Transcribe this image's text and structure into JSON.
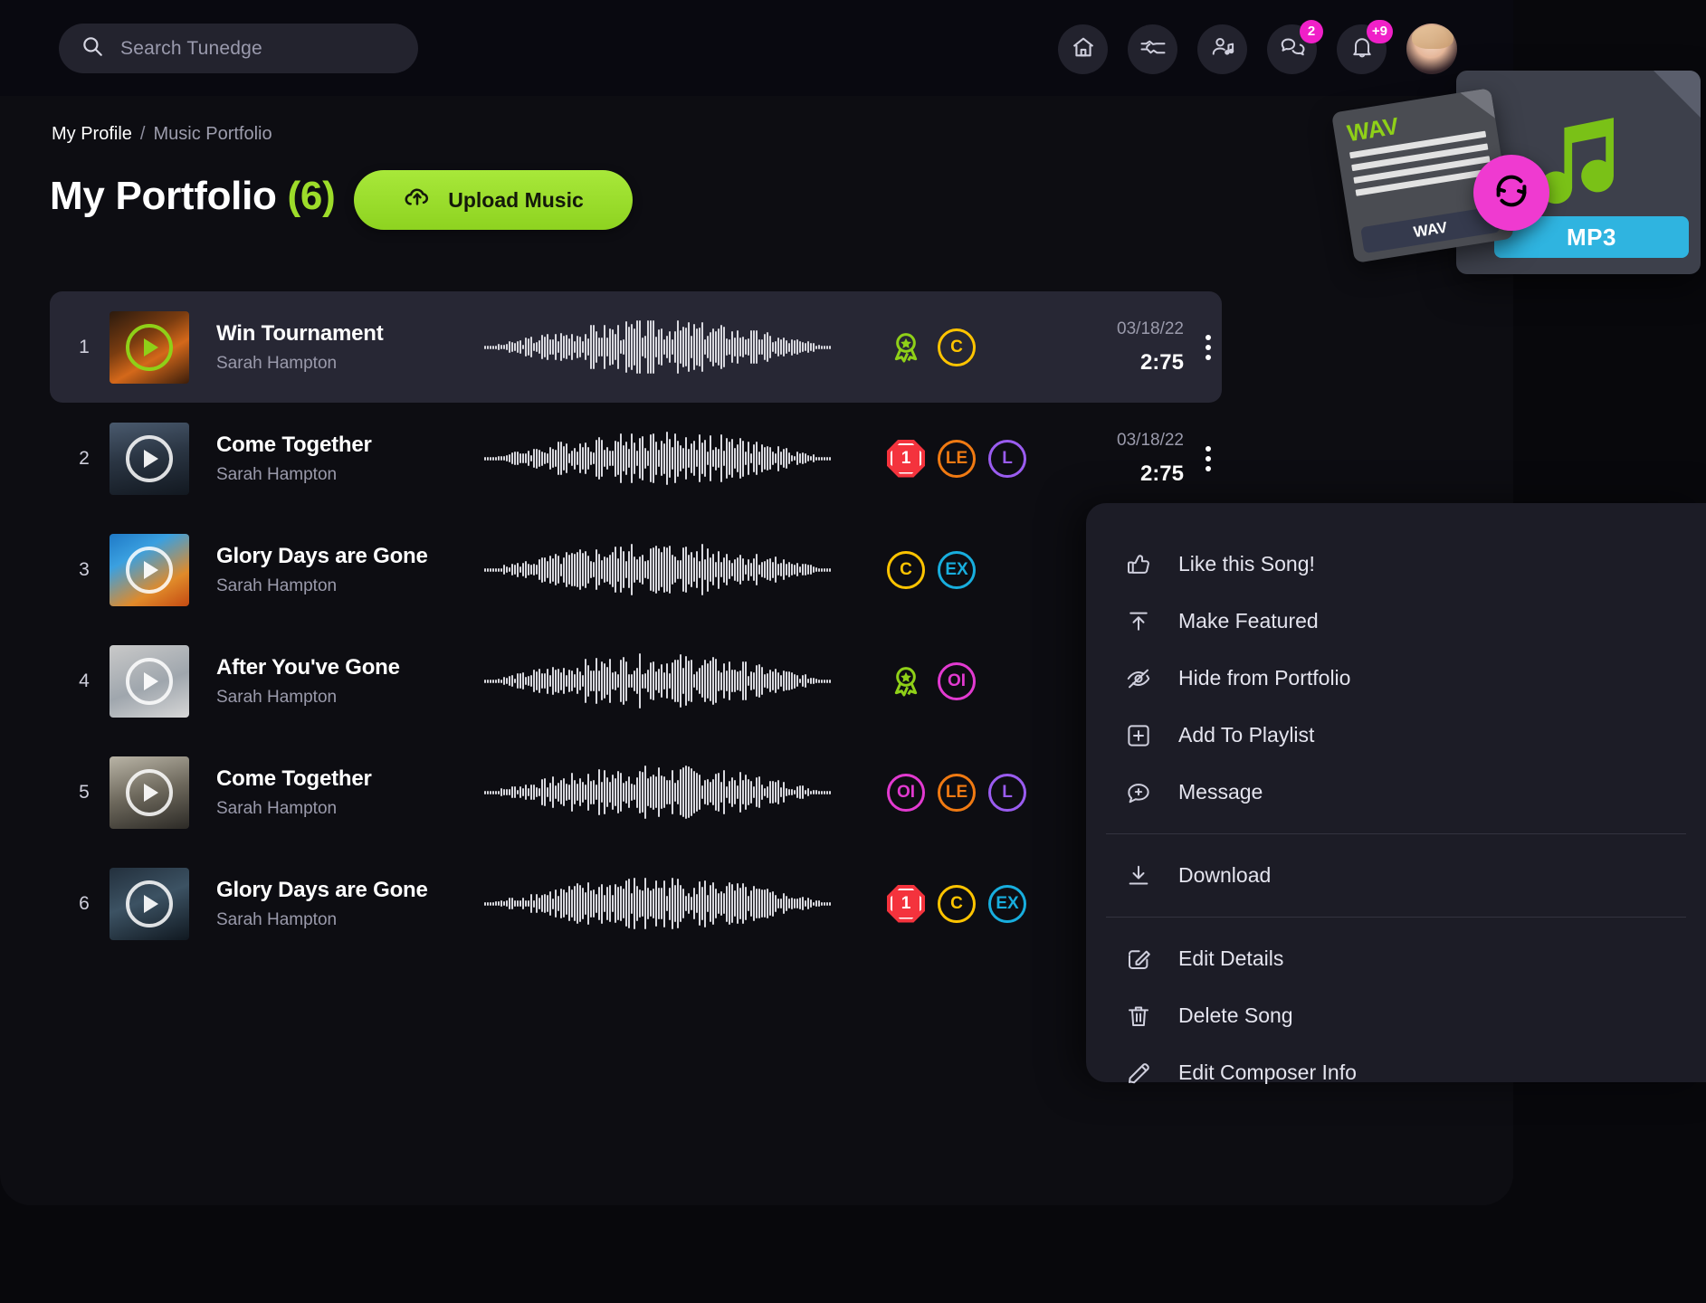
{
  "search": {
    "placeholder": "Search Tunedge",
    "icon": "search-icon"
  },
  "header": {
    "icons": [
      {
        "name": "home-icon",
        "badge": null
      },
      {
        "name": "handshake-icon",
        "badge": null
      },
      {
        "name": "user-music-icon",
        "badge": null
      },
      {
        "name": "chat-icon",
        "badge": "2"
      },
      {
        "name": "bell-icon",
        "badge": "+9"
      }
    ],
    "avatar": "user-avatar"
  },
  "breadcrumb": {
    "current": "My Profile",
    "separator": "/",
    "sub": "Music Portfolio"
  },
  "page": {
    "title": "My Portfolio",
    "count": "(6)"
  },
  "upload": {
    "label": "Upload Music",
    "icon": "cloud-upload-icon"
  },
  "converter": {
    "source_label": "WAV",
    "source_badge": "WAV",
    "target_badge": "MP3",
    "convert_icon": "refresh-convert-icon",
    "accent_source": "#8fd018",
    "accent_target": "#2fb4e0",
    "convert_bg": "#ef3ad0"
  },
  "tracks": [
    {
      "index": "1",
      "title": "Win Tournament",
      "artist": "Sarah Hampton",
      "date": "03/18/22",
      "duration": "2:75",
      "active": true,
      "thumb_art": "no-fear-album-art",
      "flags": [
        {
          "type": "award",
          "label": "",
          "color": "#8fd018"
        },
        {
          "type": "circle",
          "label": "C",
          "color": "#ffc400"
        }
      ]
    },
    {
      "index": "2",
      "title": "Come Together",
      "artist": "Sarah Hampton",
      "date": "03/18/22",
      "duration": "2:75",
      "active": false,
      "thumb_art": "stage-album-art",
      "flags": [
        {
          "type": "octagon",
          "label": "1",
          "color": "#f4333d"
        },
        {
          "type": "circle",
          "label": "LE",
          "color": "#f07a12"
        },
        {
          "type": "circle",
          "label": "L",
          "color": "#9a5cf0"
        }
      ]
    },
    {
      "index": "3",
      "title": "Glory Days are Gone",
      "artist": "Sarah Hampton",
      "date": "",
      "duration": "",
      "active": false,
      "thumb_art": "skate-album-art",
      "flags": [
        {
          "type": "circle",
          "label": "C",
          "color": "#ffc400"
        },
        {
          "type": "circle",
          "label": "EX",
          "color": "#18aede"
        }
      ]
    },
    {
      "index": "4",
      "title": "After You've Gone",
      "artist": "Sarah Hampton",
      "date": "",
      "duration": "",
      "active": false,
      "thumb_art": "crush-album-art",
      "flags": [
        {
          "type": "award",
          "label": "",
          "color": "#8fd018"
        },
        {
          "type": "circle",
          "label": "OI",
          "color": "#e23ad0"
        }
      ]
    },
    {
      "index": "5",
      "title": "Come Together",
      "artist": "Sarah Hampton",
      "date": "",
      "duration": "",
      "active": false,
      "thumb_art": "born-to-win-album-art",
      "flags": [
        {
          "type": "circle",
          "label": "OI",
          "color": "#e23ad0"
        },
        {
          "type": "circle",
          "label": "LE",
          "color": "#f07a12"
        },
        {
          "type": "circle",
          "label": "L",
          "color": "#9a5cf0"
        }
      ]
    },
    {
      "index": "6",
      "title": "Glory Days are Gone",
      "artist": "Sarah Hampton",
      "date": "",
      "duration": "",
      "active": false,
      "thumb_art": "know-how-album-art",
      "flags": [
        {
          "type": "octagon",
          "label": "1",
          "color": "#f4333d"
        },
        {
          "type": "circle",
          "label": "C",
          "color": "#ffc400"
        },
        {
          "type": "circle",
          "label": "EX",
          "color": "#18aede"
        }
      ]
    }
  ],
  "context_menu": {
    "groups": [
      [
        {
          "label": "Like this Song!",
          "icon": "thumbs-up-icon"
        },
        {
          "label": "Make Featured",
          "icon": "arrow-up-bar-icon"
        },
        {
          "label": "Hide from Portfolio",
          "icon": "eye-off-icon"
        },
        {
          "label": "Add To Playlist",
          "icon": "plus-square-icon"
        },
        {
          "label": "Message",
          "icon": "message-plus-icon"
        }
      ],
      [
        {
          "label": "Download",
          "icon": "download-icon"
        }
      ],
      [
        {
          "label": "Edit Details",
          "icon": "edit-square-icon"
        },
        {
          "label": "Delete Song",
          "icon": "trash-icon"
        },
        {
          "label": "Edit Composer Info",
          "icon": "pencil-icon"
        }
      ]
    ]
  }
}
